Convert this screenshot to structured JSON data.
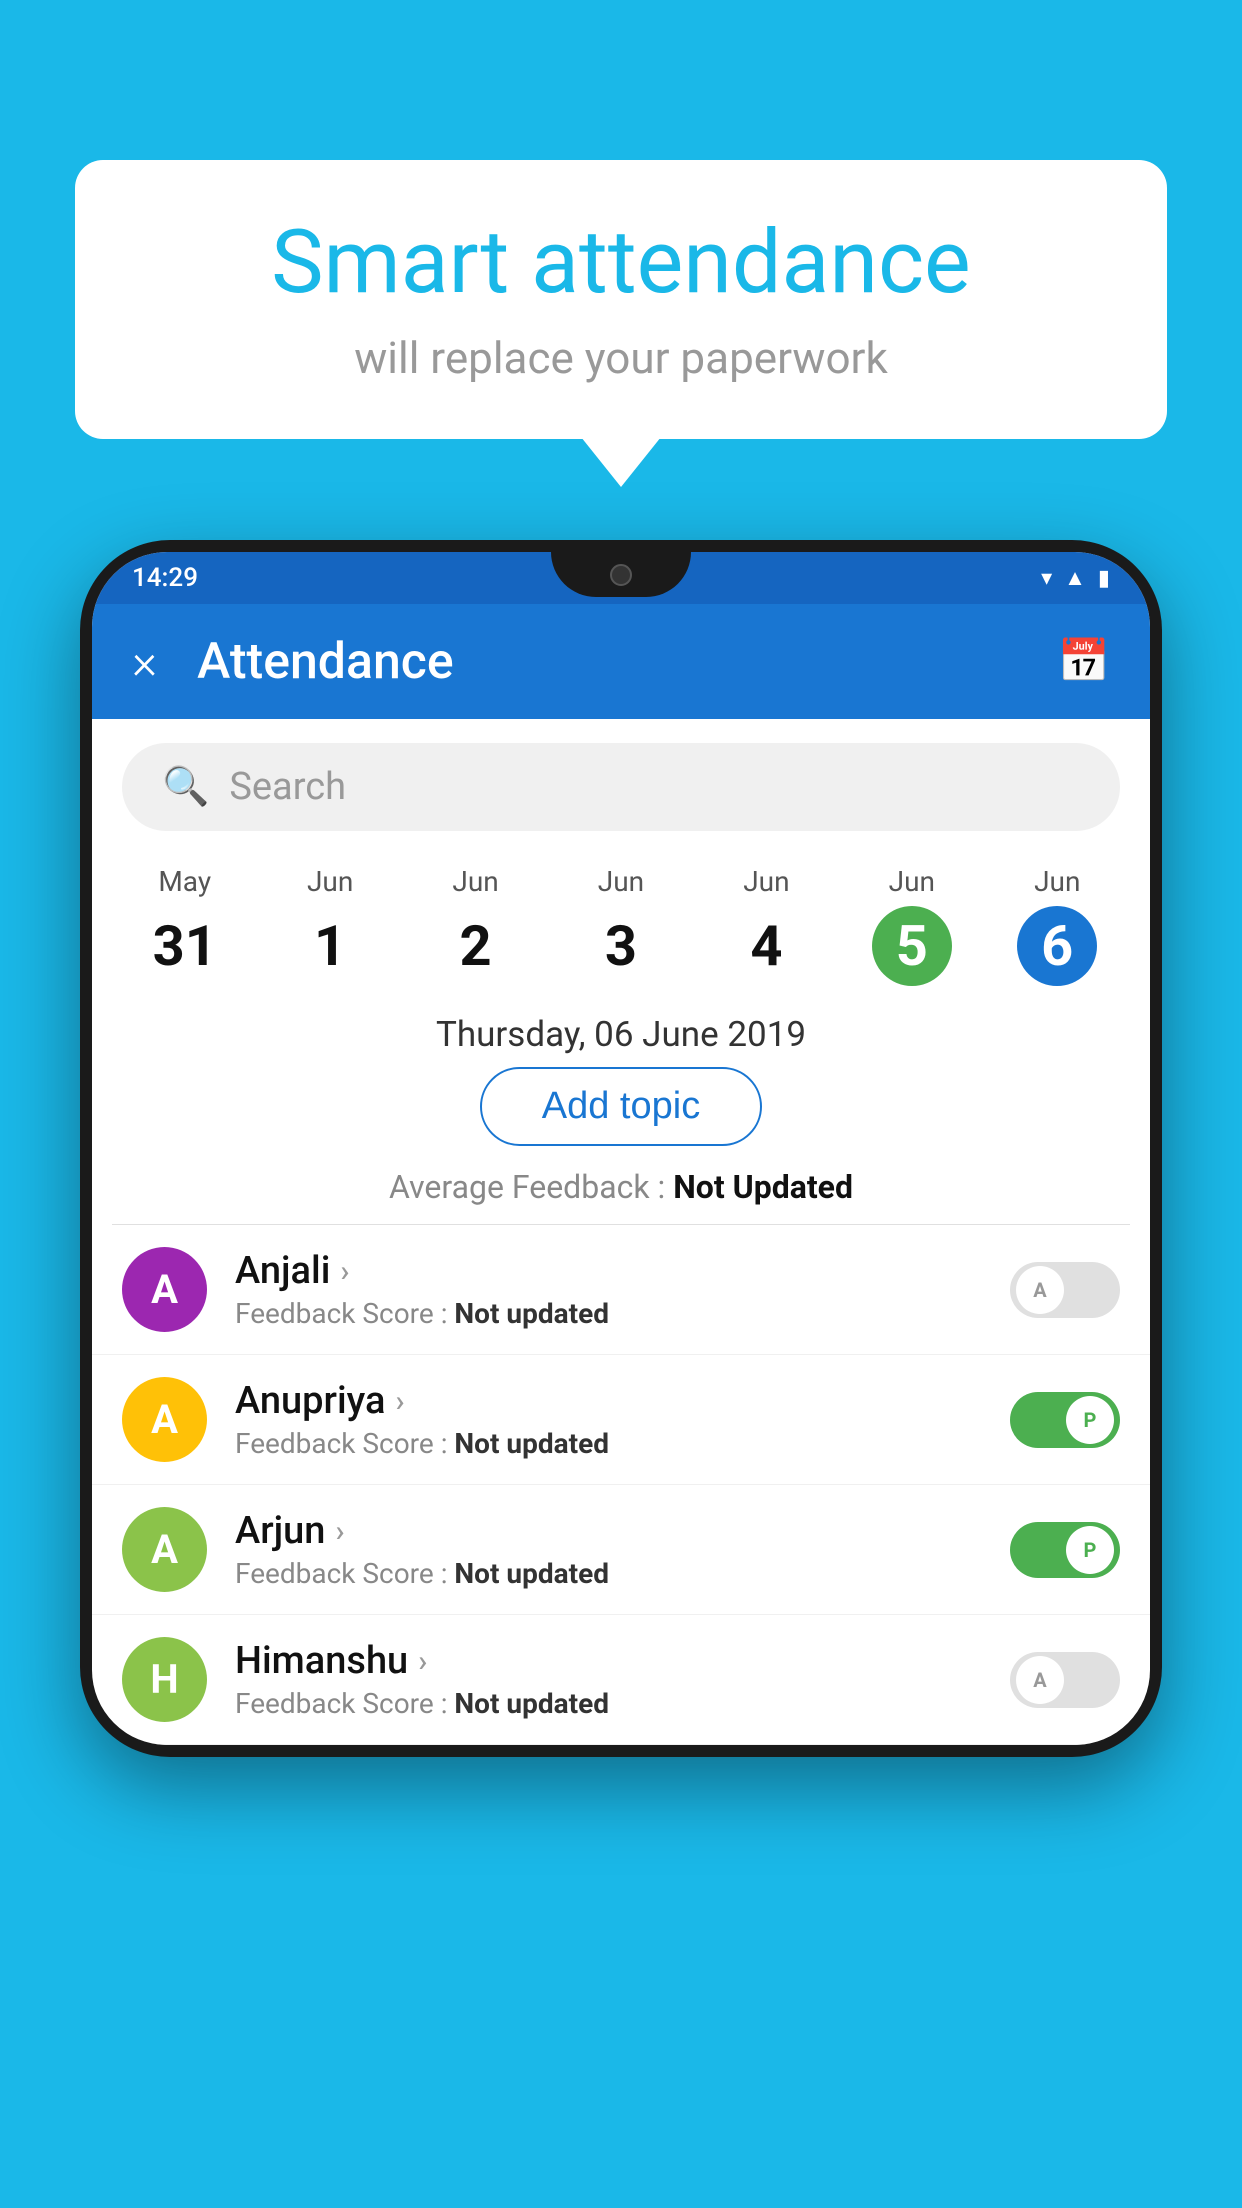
{
  "background_color": "#1ab8e8",
  "speech_bubble": {
    "title": "Smart attendance",
    "subtitle": "will replace your paperwork"
  },
  "phone": {
    "status_bar": {
      "time": "14:29",
      "icons": [
        "wifi",
        "signal",
        "battery"
      ]
    },
    "app_bar": {
      "title": "Attendance",
      "close_label": "×",
      "calendar_icon": "📅"
    },
    "search": {
      "placeholder": "Search"
    },
    "date_strip": [
      {
        "month": "May",
        "day": "31",
        "state": "normal"
      },
      {
        "month": "Jun",
        "day": "1",
        "state": "normal"
      },
      {
        "month": "Jun",
        "day": "2",
        "state": "normal"
      },
      {
        "month": "Jun",
        "day": "3",
        "state": "normal"
      },
      {
        "month": "Jun",
        "day": "4",
        "state": "normal"
      },
      {
        "month": "Jun",
        "day": "5",
        "state": "today"
      },
      {
        "month": "Jun",
        "day": "6",
        "state": "selected"
      }
    ],
    "selected_date_label": "Thursday, 06 June 2019",
    "add_topic_label": "Add topic",
    "average_feedback_label": "Average Feedback :",
    "average_feedback_value": "Not Updated",
    "students": [
      {
        "name": "Anjali",
        "initials": "A",
        "avatar_color": "#9c27b0",
        "feedback_label": "Feedback Score :",
        "feedback_value": "Not updated",
        "attendance": "off",
        "toggle_label": "A"
      },
      {
        "name": "Anupriya",
        "initials": "A",
        "avatar_color": "#ffc107",
        "feedback_label": "Feedback Score :",
        "feedback_value": "Not updated",
        "attendance": "on",
        "toggle_label": "P"
      },
      {
        "name": "Arjun",
        "initials": "A",
        "avatar_color": "#8bc34a",
        "feedback_label": "Feedback Score :",
        "feedback_value": "Not updated",
        "attendance": "on",
        "toggle_label": "P"
      },
      {
        "name": "Himanshu",
        "initials": "H",
        "avatar_color": "#8bc34a",
        "feedback_label": "Feedback Score :",
        "feedback_value": "Not updated",
        "attendance": "off",
        "toggle_label": "A"
      }
    ]
  }
}
